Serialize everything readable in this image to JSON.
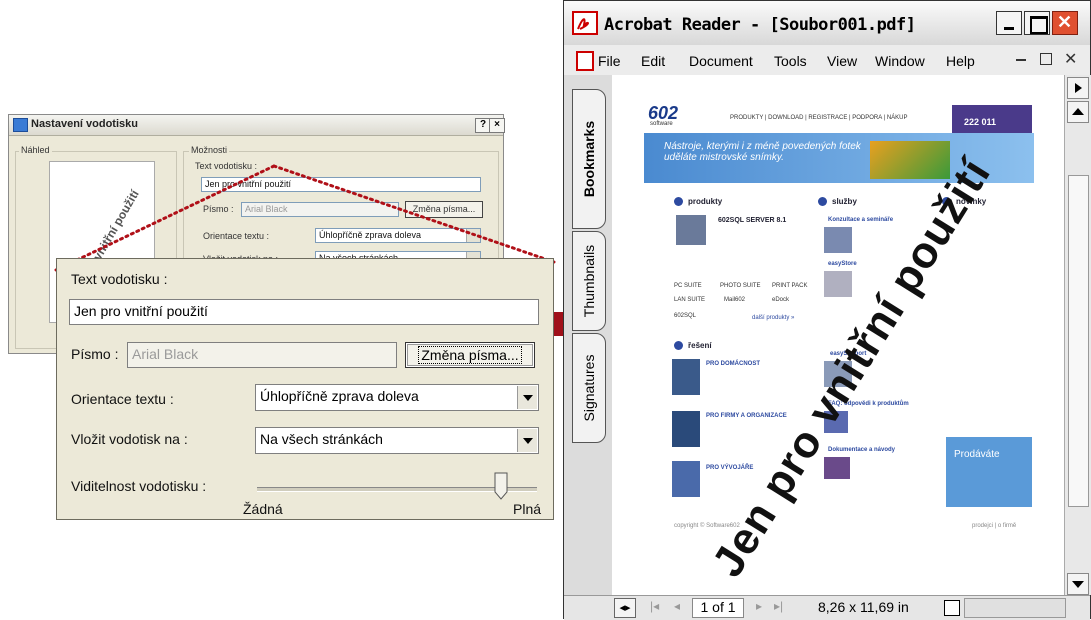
{
  "small_dialog": {
    "title": "Nastavení vodotisku",
    "help_btn": "?",
    "close_btn": "×",
    "preview_label": "Náhled",
    "preview_watermark": "Jen pro vnitřní použití",
    "options_label": "Možnosti",
    "text_label": "Text vodotisku :",
    "text_value": "Jen pro vnitřní použití",
    "font_label": "Písmo :",
    "font_value": "Arial Black",
    "font_button": "Změna písma...",
    "orientation_label": "Orientace textu :",
    "orientation_value": "Úhlopříčně zprava doleva",
    "insert_label": "Vložit vodotisk na :",
    "insert_value": "Na všech stránkách"
  },
  "zoom_panel": {
    "text_label": "Text vodotisku :",
    "text_value": "Jen pro vnitřní použití",
    "font_label": "Písmo :",
    "font_value": "Arial Black",
    "font_button": "Změna písma...",
    "orientation_label": "Orientace textu :",
    "orientation_value": "Úhlopříčně zprava doleva",
    "insert_label": "Vložit vodotisk na :",
    "insert_value": "Na všech stránkách",
    "visibility_label": "Viditelnost vodotisku :",
    "visibility_min": "Žádná",
    "visibility_max": "Plná",
    "visibility_level": 0.87
  },
  "acrobat": {
    "title": "Acrobat Reader - [Soubor001.pdf]",
    "menu": [
      "File",
      "Edit",
      "Document",
      "Tools",
      "View",
      "Window",
      "Help"
    ],
    "side_tabs": [
      "Bookmarks",
      "Thumbnails",
      "Signatures"
    ],
    "status": {
      "page": "1 of 1",
      "size": "8,26 x 11,69 in"
    },
    "watermark": "Jen pro vnitřní použití",
    "pdf_page": {
      "logo": "602",
      "logo_sub": "software",
      "nav": "PRODUKTY | DOWNLOAD | REGISTRACE | PODPORA | NÁKUP",
      "banner_text": "Nástroje, kterými i z méně povedených fotek uděláte mistrovské snímky.",
      "phone": "222 011",
      "col1_title": "produkty",
      "col2_title": "služby",
      "col3_title": "novinky",
      "product_name": "602SQL SERVER 8.1",
      "products": [
        "PC SUITE",
        "PHOTO SUITE",
        "PRINT PACK",
        "LAN SUITE",
        "Mail602",
        "eDock",
        "602SQL"
      ],
      "more_products": "další produkty »",
      "section_reseni": "řešení",
      "res1": "PRO DOMÁCNOST",
      "res2": "PRO FIRMY A ORGANIZACE",
      "res3": "PRO VÝVOJÁŘE",
      "svc1": "Konzultace a semináře",
      "svc2": "easyStore",
      "svc3": "easySupport",
      "svc4": "FAQ: odpovědi k produktům",
      "svc5": "Dokumentace a návody",
      "promo": "Prodáváte",
      "footer": "copyright © Software602",
      "footer_right": "prodejci | o firmě"
    }
  }
}
